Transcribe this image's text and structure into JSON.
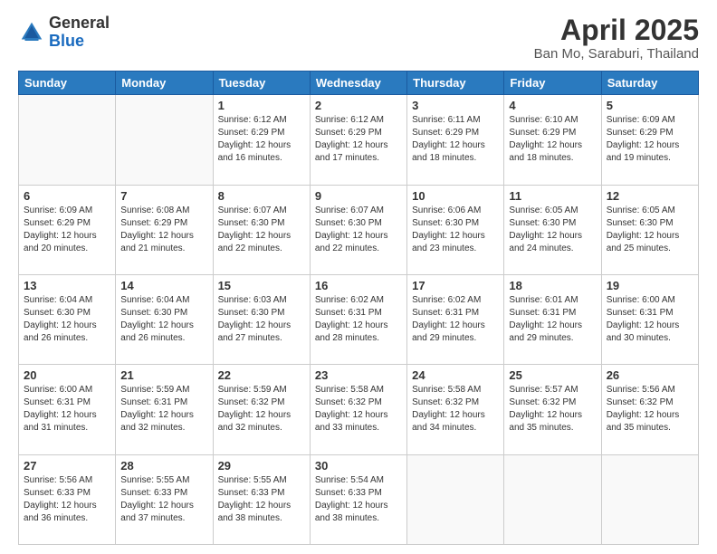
{
  "header": {
    "logo_general": "General",
    "logo_blue": "Blue",
    "main_title": "April 2025",
    "subtitle": "Ban Mo, Saraburi, Thailand"
  },
  "days_of_week": [
    "Sunday",
    "Monday",
    "Tuesday",
    "Wednesday",
    "Thursday",
    "Friday",
    "Saturday"
  ],
  "weeks": [
    [
      {
        "day": "",
        "sunrise": "",
        "sunset": "",
        "daylight": ""
      },
      {
        "day": "",
        "sunrise": "",
        "sunset": "",
        "daylight": ""
      },
      {
        "day": "1",
        "sunrise": "Sunrise: 6:12 AM",
        "sunset": "Sunset: 6:29 PM",
        "daylight": "Daylight: 12 hours and 16 minutes."
      },
      {
        "day": "2",
        "sunrise": "Sunrise: 6:12 AM",
        "sunset": "Sunset: 6:29 PM",
        "daylight": "Daylight: 12 hours and 17 minutes."
      },
      {
        "day": "3",
        "sunrise": "Sunrise: 6:11 AM",
        "sunset": "Sunset: 6:29 PM",
        "daylight": "Daylight: 12 hours and 18 minutes."
      },
      {
        "day": "4",
        "sunrise": "Sunrise: 6:10 AM",
        "sunset": "Sunset: 6:29 PM",
        "daylight": "Daylight: 12 hours and 18 minutes."
      },
      {
        "day": "5",
        "sunrise": "Sunrise: 6:09 AM",
        "sunset": "Sunset: 6:29 PM",
        "daylight": "Daylight: 12 hours and 19 minutes."
      }
    ],
    [
      {
        "day": "6",
        "sunrise": "Sunrise: 6:09 AM",
        "sunset": "Sunset: 6:29 PM",
        "daylight": "Daylight: 12 hours and 20 minutes."
      },
      {
        "day": "7",
        "sunrise": "Sunrise: 6:08 AM",
        "sunset": "Sunset: 6:29 PM",
        "daylight": "Daylight: 12 hours and 21 minutes."
      },
      {
        "day": "8",
        "sunrise": "Sunrise: 6:07 AM",
        "sunset": "Sunset: 6:30 PM",
        "daylight": "Daylight: 12 hours and 22 minutes."
      },
      {
        "day": "9",
        "sunrise": "Sunrise: 6:07 AM",
        "sunset": "Sunset: 6:30 PM",
        "daylight": "Daylight: 12 hours and 22 minutes."
      },
      {
        "day": "10",
        "sunrise": "Sunrise: 6:06 AM",
        "sunset": "Sunset: 6:30 PM",
        "daylight": "Daylight: 12 hours and 23 minutes."
      },
      {
        "day": "11",
        "sunrise": "Sunrise: 6:05 AM",
        "sunset": "Sunset: 6:30 PM",
        "daylight": "Daylight: 12 hours and 24 minutes."
      },
      {
        "day": "12",
        "sunrise": "Sunrise: 6:05 AM",
        "sunset": "Sunset: 6:30 PM",
        "daylight": "Daylight: 12 hours and 25 minutes."
      }
    ],
    [
      {
        "day": "13",
        "sunrise": "Sunrise: 6:04 AM",
        "sunset": "Sunset: 6:30 PM",
        "daylight": "Daylight: 12 hours and 26 minutes."
      },
      {
        "day": "14",
        "sunrise": "Sunrise: 6:04 AM",
        "sunset": "Sunset: 6:30 PM",
        "daylight": "Daylight: 12 hours and 26 minutes."
      },
      {
        "day": "15",
        "sunrise": "Sunrise: 6:03 AM",
        "sunset": "Sunset: 6:30 PM",
        "daylight": "Daylight: 12 hours and 27 minutes."
      },
      {
        "day": "16",
        "sunrise": "Sunrise: 6:02 AM",
        "sunset": "Sunset: 6:31 PM",
        "daylight": "Daylight: 12 hours and 28 minutes."
      },
      {
        "day": "17",
        "sunrise": "Sunrise: 6:02 AM",
        "sunset": "Sunset: 6:31 PM",
        "daylight": "Daylight: 12 hours and 29 minutes."
      },
      {
        "day": "18",
        "sunrise": "Sunrise: 6:01 AM",
        "sunset": "Sunset: 6:31 PM",
        "daylight": "Daylight: 12 hours and 29 minutes."
      },
      {
        "day": "19",
        "sunrise": "Sunrise: 6:00 AM",
        "sunset": "Sunset: 6:31 PM",
        "daylight": "Daylight: 12 hours and 30 minutes."
      }
    ],
    [
      {
        "day": "20",
        "sunrise": "Sunrise: 6:00 AM",
        "sunset": "Sunset: 6:31 PM",
        "daylight": "Daylight: 12 hours and 31 minutes."
      },
      {
        "day": "21",
        "sunrise": "Sunrise: 5:59 AM",
        "sunset": "Sunset: 6:31 PM",
        "daylight": "Daylight: 12 hours and 32 minutes."
      },
      {
        "day": "22",
        "sunrise": "Sunrise: 5:59 AM",
        "sunset": "Sunset: 6:32 PM",
        "daylight": "Daylight: 12 hours and 32 minutes."
      },
      {
        "day": "23",
        "sunrise": "Sunrise: 5:58 AM",
        "sunset": "Sunset: 6:32 PM",
        "daylight": "Daylight: 12 hours and 33 minutes."
      },
      {
        "day": "24",
        "sunrise": "Sunrise: 5:58 AM",
        "sunset": "Sunset: 6:32 PM",
        "daylight": "Daylight: 12 hours and 34 minutes."
      },
      {
        "day": "25",
        "sunrise": "Sunrise: 5:57 AM",
        "sunset": "Sunset: 6:32 PM",
        "daylight": "Daylight: 12 hours and 35 minutes."
      },
      {
        "day": "26",
        "sunrise": "Sunrise: 5:56 AM",
        "sunset": "Sunset: 6:32 PM",
        "daylight": "Daylight: 12 hours and 35 minutes."
      }
    ],
    [
      {
        "day": "27",
        "sunrise": "Sunrise: 5:56 AM",
        "sunset": "Sunset: 6:33 PM",
        "daylight": "Daylight: 12 hours and 36 minutes."
      },
      {
        "day": "28",
        "sunrise": "Sunrise: 5:55 AM",
        "sunset": "Sunset: 6:33 PM",
        "daylight": "Daylight: 12 hours and 37 minutes."
      },
      {
        "day": "29",
        "sunrise": "Sunrise: 5:55 AM",
        "sunset": "Sunset: 6:33 PM",
        "daylight": "Daylight: 12 hours and 38 minutes."
      },
      {
        "day": "30",
        "sunrise": "Sunrise: 5:54 AM",
        "sunset": "Sunset: 6:33 PM",
        "daylight": "Daylight: 12 hours and 38 minutes."
      },
      {
        "day": "",
        "sunrise": "",
        "sunset": "",
        "daylight": ""
      },
      {
        "day": "",
        "sunrise": "",
        "sunset": "",
        "daylight": ""
      },
      {
        "day": "",
        "sunrise": "",
        "sunset": "",
        "daylight": ""
      }
    ]
  ]
}
